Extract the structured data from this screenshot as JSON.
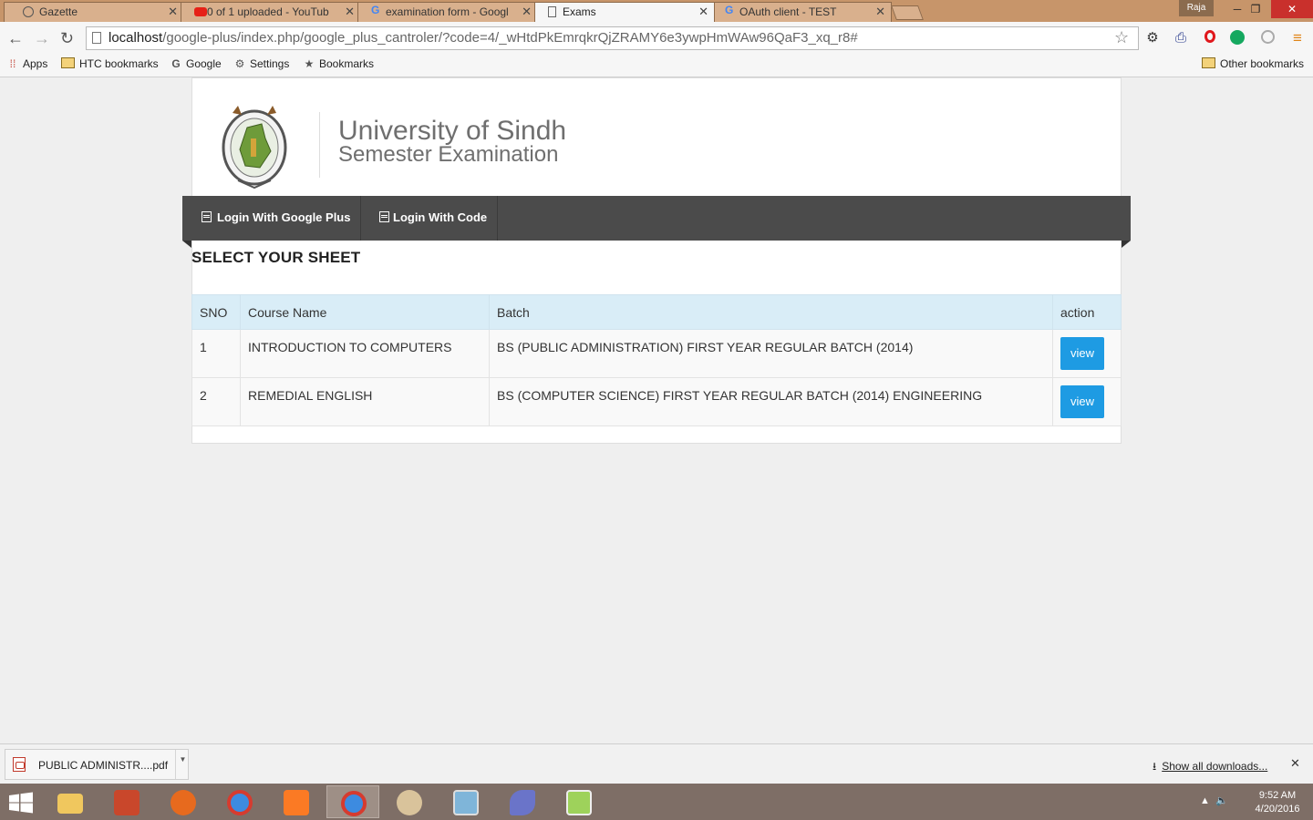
{
  "browser": {
    "tabs": [
      {
        "title": "Gazette",
        "icon": "gazette-icon"
      },
      {
        "title": "0 of 1 uploaded - YouTub",
        "icon": "youtube-icon"
      },
      {
        "title": "examination form - Googl",
        "icon": "google-icon"
      },
      {
        "title": "Exams",
        "icon": "page-icon"
      },
      {
        "title": "OAuth client - TEST",
        "icon": "google-icon"
      }
    ],
    "active_tab": 3,
    "user_badge": "Raja",
    "url_host": "localhost",
    "url_path": "/google-plus/index.php/google_plus_cantroler/?code=4/_wHtdPkEmrqkrQjZRAMY6e3ywpHmWAw96QaF3_xq_r8#",
    "bookmarks": [
      {
        "label": "Apps",
        "icon": "apps-grid-icon"
      },
      {
        "label": "HTC bookmarks",
        "icon": "folder-icon"
      },
      {
        "label": "Google",
        "icon": "google-icon"
      },
      {
        "label": "Settings",
        "icon": "gear-icon"
      },
      {
        "label": "Bookmarks",
        "icon": "star-icon"
      }
    ],
    "other_bookmarks": "Other bookmarks"
  },
  "site": {
    "title": "University of Sindh",
    "subtitle": "Semester Examination",
    "nav": [
      {
        "label": "Login With Google Plus"
      },
      {
        "label": "Login With Code"
      }
    ]
  },
  "sheet": {
    "heading": "SELECT YOUR SHEET",
    "columns": [
      "SNO",
      "Course Name",
      "Batch",
      "action"
    ],
    "rows": [
      {
        "sno": "1",
        "course": "INTRODUCTION TO COMPUTERS",
        "batch": "BS (PUBLIC ADMINISTRATION) FIRST YEAR REGULAR BATCH (2014)",
        "action": "view"
      },
      {
        "sno": "2",
        "course": "REMEDIAL ENGLISH",
        "batch": "BS (COMPUTER SCIENCE) FIRST YEAR REGULAR BATCH (2014) ENGINEERING",
        "action": "view"
      }
    ]
  },
  "downloads": {
    "file": "PUBLIC ADMINISTR....pdf",
    "show_all": "Show all downloads..."
  },
  "taskbar": {
    "time": "9:52 AM",
    "date": "4/20/2016"
  },
  "colors": {
    "nav_bg": "#4b4b4b",
    "table_header": "#d9edf7",
    "button": "#1e9be3",
    "taskbar": "#7e6e66"
  }
}
